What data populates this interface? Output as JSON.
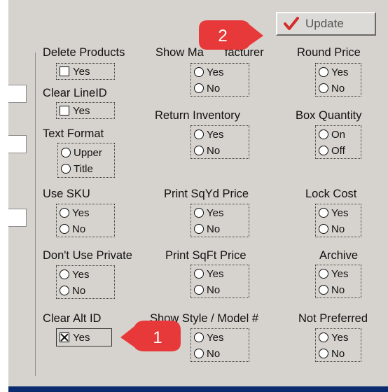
{
  "update_button": {
    "label": "Update",
    "icon": "checkmark-icon",
    "icon_color": "#d42b2b"
  },
  "callouts": [
    {
      "number": "1",
      "color": "#e8393a"
    },
    {
      "number": "2",
      "color": "#e8393a"
    }
  ],
  "left_column": {
    "delete_products": {
      "label": "Delete Products",
      "option": "Yes",
      "checked": false
    },
    "clear_lineid": {
      "label": "Clear LineID",
      "option": "Yes",
      "checked": false
    },
    "text_format": {
      "label": "Text Format",
      "options": [
        "Upper",
        "Title"
      ]
    },
    "use_sku": {
      "label": "Use SKU",
      "options": [
        "Yes",
        "No"
      ]
    },
    "dont_use_private": {
      "label": "Don't Use Private",
      "options": [
        "Yes",
        "No"
      ]
    },
    "clear_alt_id": {
      "label": "Clear Alt ID",
      "option": "Yes",
      "checked": true
    }
  },
  "middle_column": {
    "show_manufacturer": {
      "label": "Show Ma",
      "label_tail": "facturer",
      "options": [
        "Yes",
        "No"
      ]
    },
    "return_inventory": {
      "label": "Return Inventory",
      "options": [
        "Yes",
        "No"
      ]
    },
    "print_sqyd_price": {
      "label": "Print SqYd Price",
      "options": [
        "Yes",
        "No"
      ]
    },
    "print_sqft_price": {
      "label": "Print SqFt Price",
      "options": [
        "Yes",
        "No"
      ]
    },
    "show_style_model": {
      "label": "Show Style / Model #",
      "options": [
        "Yes",
        "No"
      ]
    }
  },
  "right_column": {
    "round_price": {
      "label": "Round Price",
      "options": [
        "Yes",
        "No"
      ]
    },
    "box_quantity": {
      "label": "Box Quantity",
      "options": [
        "On",
        "Off"
      ]
    },
    "lock_cost": {
      "label": "Lock Cost",
      "options": [
        "Yes",
        "No"
      ]
    },
    "archive": {
      "label": "Archive",
      "options": [
        "Yes",
        "No"
      ]
    },
    "not_preferred": {
      "label": "Not Preferred",
      "options": [
        "Yes",
        "No"
      ]
    }
  }
}
